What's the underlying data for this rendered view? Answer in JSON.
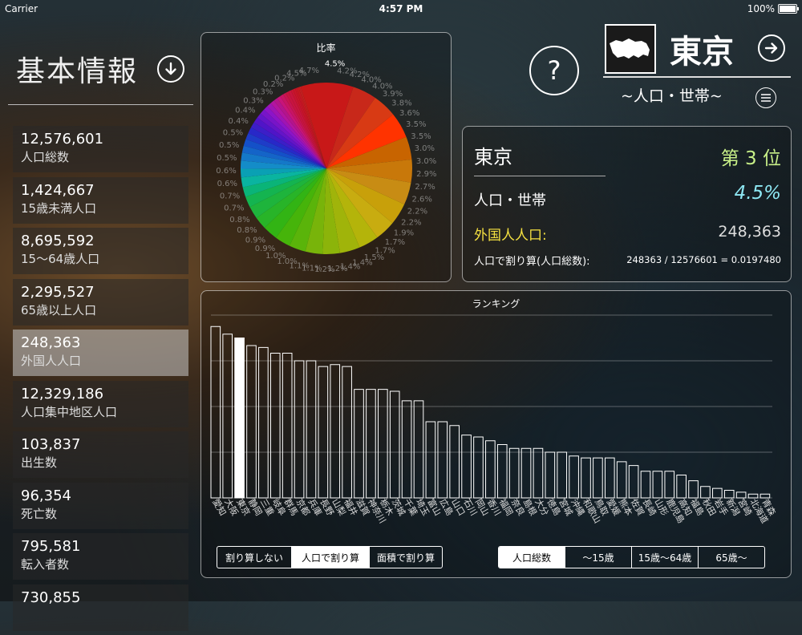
{
  "status_bar": {
    "carrier": "Carrier",
    "time": "4:57 PM",
    "battery": "100%"
  },
  "sidebar": {
    "title": "基本情報",
    "items": [
      {
        "value": "12,576,601",
        "label": "人口総数"
      },
      {
        "value": "1,424,667",
        "label": "15歳未満人口"
      },
      {
        "value": "8,695,592",
        "label": "15～64歳人口"
      },
      {
        "value": "2,295,527",
        "label": "65歳以上人口"
      },
      {
        "value": "248,363",
        "label": "外国人人口",
        "active": true
      },
      {
        "value": "12,329,186",
        "label": "人口集中地区人口"
      },
      {
        "value": "103,837",
        "label": "出生数"
      },
      {
        "value": "96,354",
        "label": "死亡数"
      },
      {
        "value": "795,581",
        "label": "転入者数"
      },
      {
        "value": "730,855",
        "label": ""
      }
    ]
  },
  "header": {
    "prefecture": "東京",
    "subtitle": "~人口・世帯~",
    "help": "?"
  },
  "info_panel": {
    "prefecture": "東京",
    "rank": "第 3 位",
    "category": "人口・世帯",
    "percent": "4.5%",
    "stat_label": "外国人人口:",
    "stat_value": "248,363",
    "formula_label": "人口で割り算(人口総数):",
    "formula": "248363 / 12576601 = 0.0197480"
  },
  "pie_panel": {
    "title": "比率",
    "labels": [
      "4.5%",
      "4.2%",
      "4.2%",
      "4.0%",
      "4.0%",
      "3.9%",
      "3.8%",
      "3.6%",
      "3.5%",
      "3.5%",
      "3.0%",
      "3.0%",
      "2.9%",
      "2.7%",
      "2.6%",
      "2.2%",
      "2.2%",
      "1.9%",
      "1.7%",
      "1.7%",
      "1.5%",
      "1.4%",
      "1.4%",
      "1.2%",
      "1.2%",
      "1.1%",
      "1.1%",
      "1.0%",
      "1.0%",
      "0.9%",
      "0.9%",
      "0.8%",
      "0.8%",
      "0.7%",
      "0.7%",
      "0.6%",
      "0.6%",
      "0.5%",
      "0.5%",
      "0.5%",
      "0.4%",
      "0.4%",
      "0.3%",
      "0.3%",
      "0.2%",
      "0.2%",
      "4.5%",
      "4.7%"
    ]
  },
  "ranking_panel": {
    "title": "ランキング",
    "divide_modes": [
      "割り算しない",
      "人口で割り算",
      "面積で割り算"
    ],
    "divide_selected": 1,
    "age_modes": [
      "人口総数",
      "～15歳",
      "15歳～64歳",
      "65歳～"
    ],
    "age_selected": 0
  },
  "chart_data": {
    "type": "bar",
    "title": "ランキング",
    "categories": [
      "愛知",
      "大阪",
      "東京",
      "静岡",
      "三重",
      "岐阜",
      "群馬",
      "京都",
      "兵庫",
      "長野",
      "山梨",
      "福井",
      "滋賀",
      "神奈川",
      "栃木",
      "茨城",
      "千葉",
      "埼玉",
      "富山",
      "広島",
      "山口",
      "石川",
      "岡山",
      "香川",
      "福岡",
      "奈良",
      "島根",
      "大分",
      "徳島",
      "宮城",
      "沖縄",
      "和歌山",
      "鳥取",
      "愛媛",
      "熊本",
      "佐賀",
      "長崎",
      "山形",
      "鹿児島",
      "高知",
      "福島",
      "秋田",
      "岩手",
      "新潟",
      "宮崎",
      "北海道",
      "青森"
    ],
    "values": [
      4.5,
      4.3,
      4.2,
      4.0,
      3.95,
      3.8,
      3.8,
      3.6,
      3.6,
      3.45,
      3.5,
      3.45,
      2.85,
      2.85,
      2.85,
      2.8,
      2.55,
      2.55,
      2.0,
      2.0,
      1.9,
      1.65,
      1.6,
      1.5,
      1.4,
      1.3,
      1.3,
      1.3,
      1.2,
      1.2,
      1.1,
      1.05,
      1.05,
      1.05,
      0.95,
      0.85,
      0.7,
      0.7,
      0.7,
      0.6,
      0.45,
      0.3,
      0.25,
      0.2,
      0.15,
      0.1,
      0.1
    ],
    "highlight_index": 2,
    "ylim": [
      0,
      4.8
    ]
  }
}
